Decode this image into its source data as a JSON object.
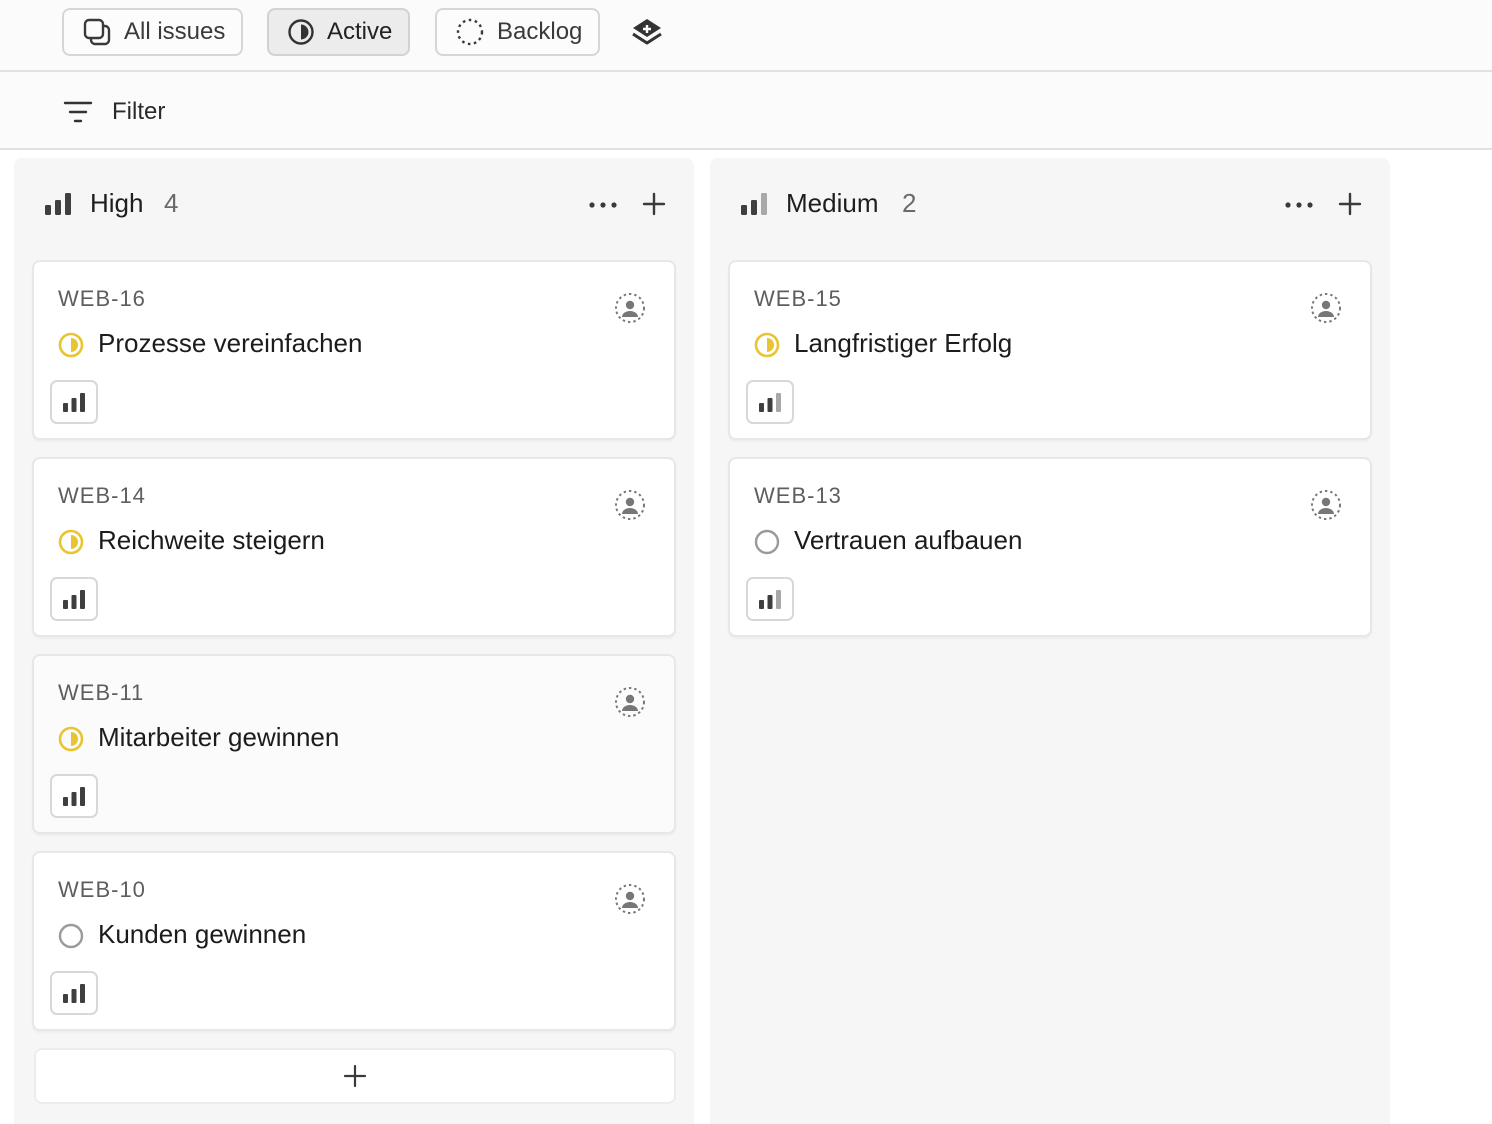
{
  "views": [
    {
      "label": "All issues",
      "icon": "copy-icon",
      "active": false
    },
    {
      "label": "Active",
      "icon": "half-circle-icon",
      "active": true
    },
    {
      "label": "Backlog",
      "icon": "dashed-circle-icon",
      "active": false
    }
  ],
  "layers_icon": "layers-icon",
  "filter": {
    "label": "Filter",
    "icon": "filter-icon"
  },
  "columns": [
    {
      "title": "High",
      "count": "4",
      "priority": "high",
      "cards": [
        {
          "id": "WEB-16",
          "title": "Prozesse vereinfachen",
          "status": "in-progress"
        },
        {
          "id": "WEB-14",
          "title": "Reichweite steigern",
          "status": "in-progress"
        },
        {
          "id": "WEB-11",
          "title": "Mitarbeiter gewinnen",
          "status": "in-progress"
        },
        {
          "id": "WEB-10",
          "title": "Kunden gewinnen",
          "status": "todo"
        }
      ]
    },
    {
      "title": "Medium",
      "count": "2",
      "priority": "medium",
      "cards": [
        {
          "id": "WEB-15",
          "title": "Langfristiger Erfolg",
          "status": "in-progress"
        },
        {
          "id": "WEB-13",
          "title": "Vertrauen aufbauen",
          "status": "todo"
        }
      ]
    }
  ],
  "colors": {
    "in_progress": "#e8c430",
    "todo": "#9a9a9a",
    "bar": "#3f3f3f",
    "bar_dim": "#a8a8a8"
  }
}
